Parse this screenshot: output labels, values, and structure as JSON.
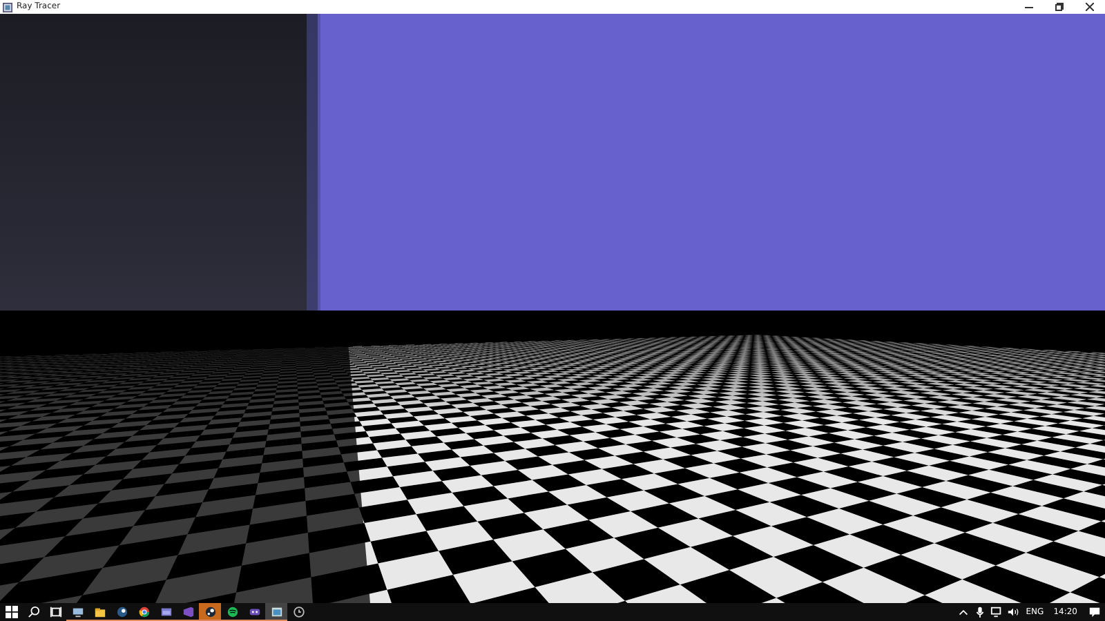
{
  "window": {
    "title": "Ray Tracer"
  },
  "taskbar": {
    "apps": [
      {
        "selected": false,
        "attention": false
      },
      {
        "selected": false,
        "attention": false
      },
      {
        "selected": false,
        "attention": false
      },
      {
        "selected": false,
        "attention": false
      },
      {
        "selected": false,
        "attention": false
      },
      {
        "selected": false,
        "attention": false
      },
      {
        "selected": false,
        "attention": true
      },
      {
        "selected": false,
        "attention": false
      },
      {
        "selected": false,
        "attention": false
      },
      {
        "selected": true,
        "attention": false
      },
      {
        "selected": false,
        "attention": false
      }
    ],
    "language": "ENG",
    "clock": "14:20"
  }
}
